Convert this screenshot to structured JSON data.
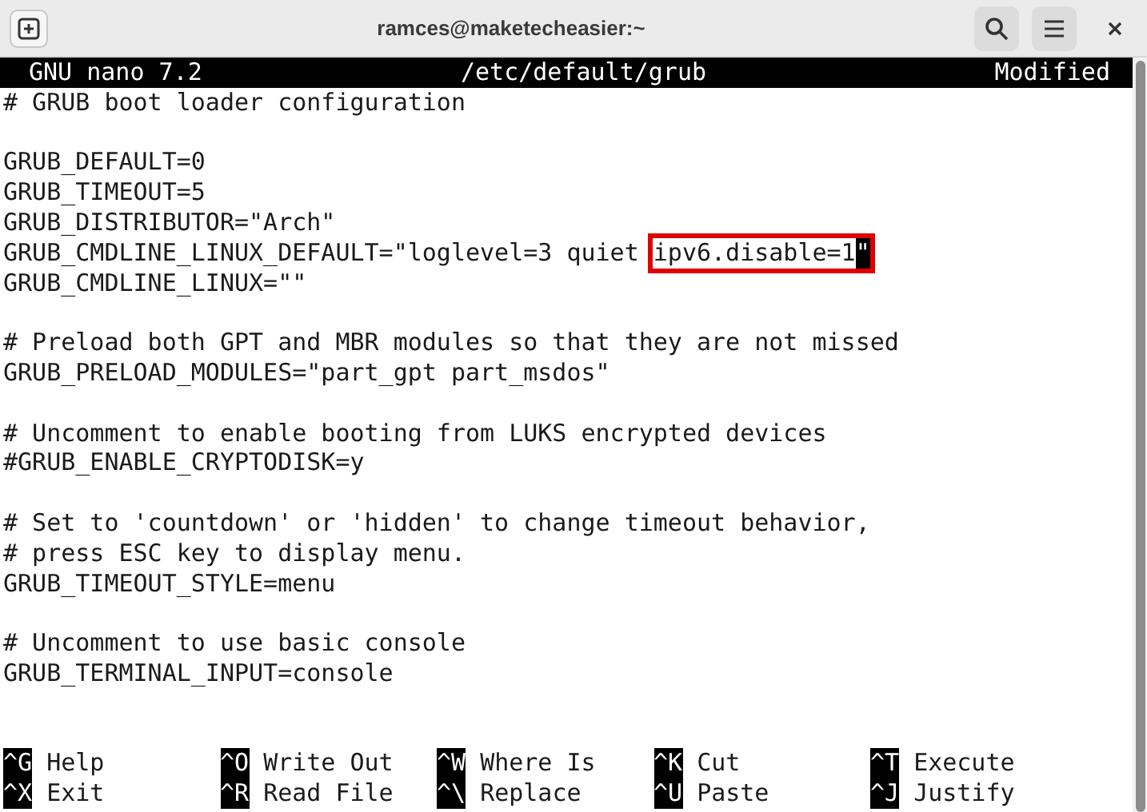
{
  "window": {
    "title": "ramces@maketecheasier:~"
  },
  "nano_header": {
    "version": "GNU nano 7.2",
    "file": "/etc/default/grub",
    "status": "Modified"
  },
  "blocks": [
    [
      "# GRUB boot loader configuration"
    ],
    [
      "GRUB_DEFAULT=0",
      "GRUB_TIMEOUT=5",
      "GRUB_DISTRIBUTOR=\"Arch\"",
      {
        "parts": [
          {
            "kind": "plain",
            "text": "GRUB_CMDLINE_LINUX_DEFAULT=\"loglevel=3 quiet "
          },
          {
            "kind": "marked",
            "text": "ipv6.disable=1",
            "cursor": "\""
          }
        ]
      },
      "GRUB_CMDLINE_LINUX=\"\""
    ],
    [
      "# Preload both GPT and MBR modules so that they are not missed",
      "GRUB_PRELOAD_MODULES=\"part_gpt part_msdos\""
    ],
    [
      "# Uncomment to enable booting from LUKS encrypted devices",
      "#GRUB_ENABLE_CRYPTODISK=y"
    ],
    [
      "# Set to 'countdown' or 'hidden' to change timeout behavior,",
      "# press ESC key to display menu.",
      "GRUB_TIMEOUT_STYLE=menu"
    ],
    [
      "# Uncomment to use basic console",
      "GRUB_TERMINAL_INPUT=console"
    ]
  ],
  "shortcuts": [
    [
      {
        "key": "^G",
        "label": "Help"
      },
      {
        "key": "^O",
        "label": "Write Out"
      },
      {
        "key": "^W",
        "label": "Where Is"
      },
      {
        "key": "^K",
        "label": "Cut"
      },
      {
        "key": "^T",
        "label": "Execute"
      }
    ],
    [
      {
        "key": "^X",
        "label": "Exit"
      },
      {
        "key": "^R",
        "label": "Read File"
      },
      {
        "key": "^\\",
        "label": "Replace"
      },
      {
        "key": "^U",
        "label": "Paste"
      },
      {
        "key": "^J",
        "label": "Justify"
      }
    ]
  ]
}
